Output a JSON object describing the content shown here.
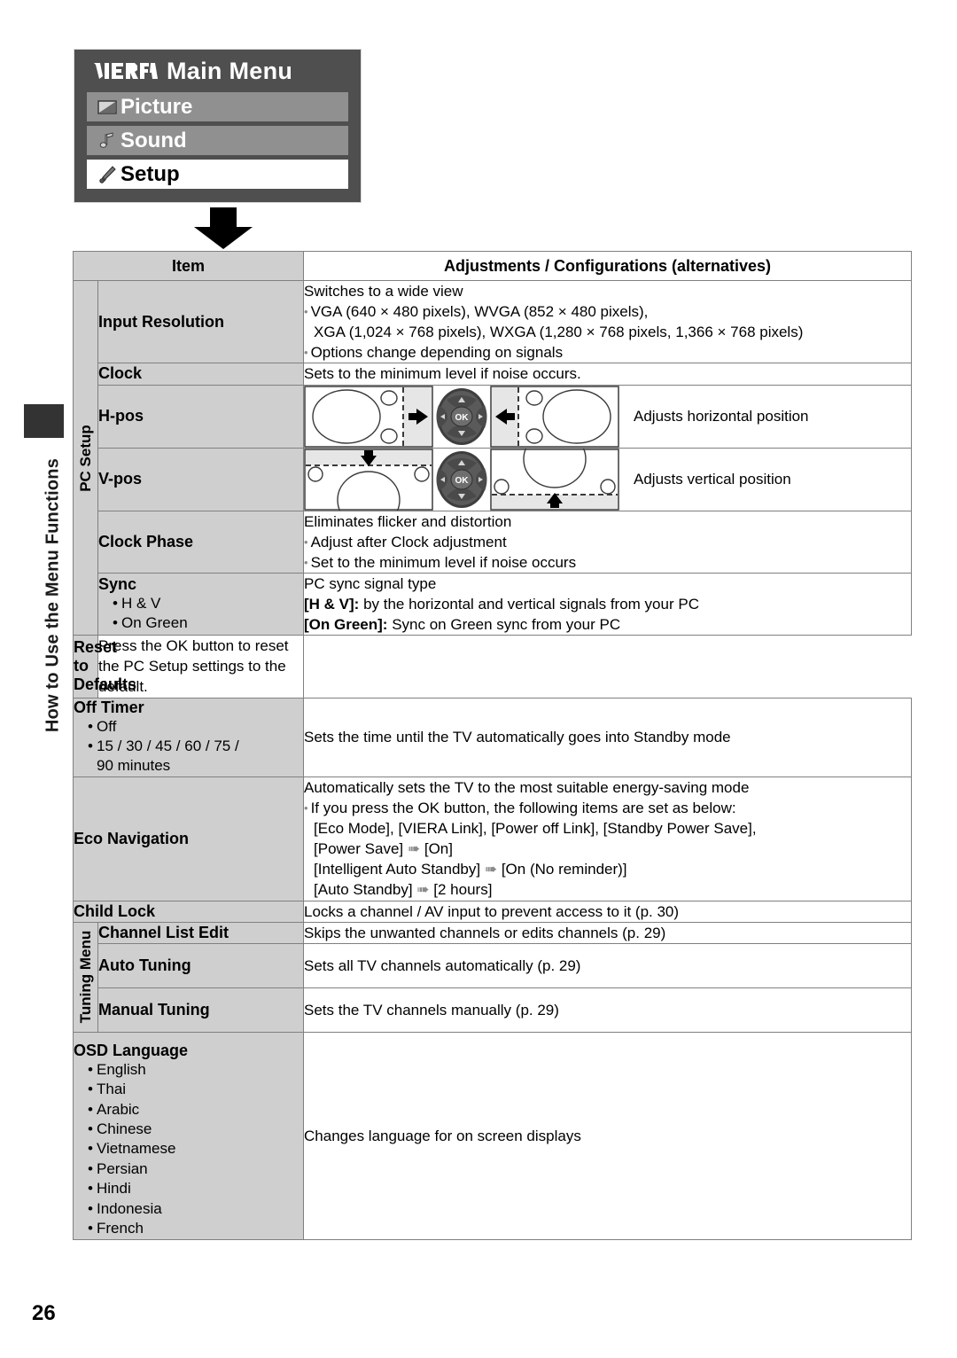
{
  "sidebar": {
    "vertical_label": "How to Use the Menu Functions"
  },
  "page": {
    "number": "26"
  },
  "menu": {
    "logo": "viera-logo",
    "title": "Main Menu",
    "items": [
      {
        "label": "Picture",
        "icon": "picture-icon",
        "state": "normal"
      },
      {
        "label": "Sound",
        "icon": "sound-note-icon",
        "state": "normal"
      },
      {
        "label": "Setup",
        "icon": "setup-wrench-icon",
        "state": "selected"
      }
    ]
  },
  "table": {
    "headers": {
      "item": "Item",
      "adjustments": "Adjustments / Configurations (alternatives)"
    },
    "groups": {
      "pc_setup": "PC Setup",
      "tuning_menu": "Tuning Menu"
    },
    "rows": {
      "input_resolution": {
        "item": "Input Resolution",
        "line1": "Switches to a wide view",
        "b1a": "VGA (640 × 480 pixels), WVGA (852 × 480 pixels),",
        "b1b": "XGA (1,024 × 768 pixels), WXGA (1,280 × 768 pixels, 1,366 × 768 pixels)",
        "b2": "Options change depending on signals"
      },
      "clock": {
        "item": "Clock",
        "desc": "Sets to the minimum level if noise occurs."
      },
      "hpos": {
        "item": "H-pos",
        "desc": "Adjusts horizontal position"
      },
      "vpos": {
        "item": "V-pos",
        "desc": "Adjusts vertical position"
      },
      "clock_phase": {
        "item": "Clock Phase",
        "line1": "Eliminates flicker and distortion",
        "b1": "Adjust after Clock adjustment",
        "b2": "Set to the minimum level if noise occurs"
      },
      "sync": {
        "item": "Sync",
        "opt1": "H & V",
        "opt2": "On Green",
        "line1": "PC sync signal type",
        "line2_b": "[H & V]:",
        "line2_t": " by the horizontal and vertical signals from your PC",
        "line3_b": "[On Green]:",
        "line3_t": " Sync on Green sync from your PC"
      },
      "reset_defaults": {
        "item": "Reset to Defaults",
        "desc": "Press the OK button to reset the PC Setup settings to the default."
      },
      "off_timer": {
        "item": "Off Timer",
        "opt1": "Off",
        "opt2": "15 / 30 / 45 / 60 / 75 /",
        "opt2b": "90 minutes",
        "desc": "Sets the time until the TV automatically goes into Standby mode"
      },
      "eco_navigation": {
        "item": "Eco Navigation",
        "line1": "Automatically sets the TV to the most suitable energy-saving mode",
        "b1": "If you press the OK button, the following items are set as below:",
        "l2": "[Eco Mode], [VIERA Link], [Power off Link], [Standby Power Save],",
        "l3a": "[Power Save]",
        "l3b": "[On]",
        "l4a": "[Intelligent Auto Standby]",
        "l4b": "[On (No reminder)]",
        "l5a": "[Auto Standby]",
        "l5b": "[2 hours]"
      },
      "child_lock": {
        "item": "Child Lock",
        "desc": "Locks a channel / AV input to prevent access to it (p. 30)"
      },
      "channel_list_edit": {
        "item": "Channel List Edit",
        "desc": "Skips the unwanted channels or edits channels (p. 29)"
      },
      "auto_tuning": {
        "item": "Auto Tuning",
        "desc": "Sets all TV channels automatically (p. 29)"
      },
      "manual_tuning": {
        "item": "Manual Tuning",
        "desc": "Sets the TV channels manually (p. 29)"
      },
      "osd_language": {
        "item": "OSD Language",
        "options": [
          "English",
          "Thai",
          "Arabic",
          "Chinese",
          "Vietnamese",
          "Persian",
          "Hindi",
          "Indonesia",
          "French"
        ],
        "desc": "Changes language for on screen displays"
      }
    }
  },
  "colors": {
    "panel_bg": "#4f4f4f",
    "row_mid": "#909090",
    "row_selected": "#ffffff",
    "table_gray": "#cfcfcf",
    "border": "#808080"
  }
}
